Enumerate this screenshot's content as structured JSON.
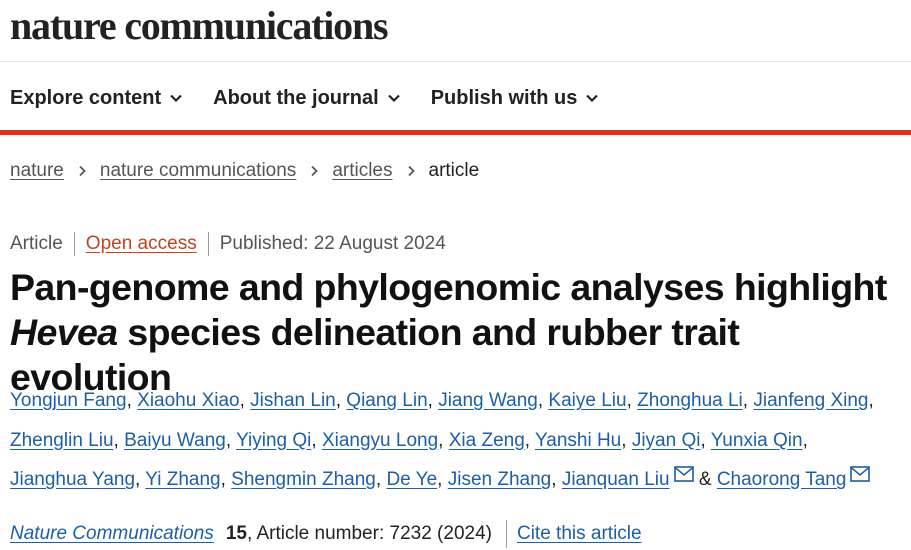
{
  "site": {
    "logo_text": "nature communications"
  },
  "nav": {
    "items": [
      {
        "label": "Explore content",
        "icon": "chevron-down-icon"
      },
      {
        "label": "About the journal",
        "icon": "chevron-down-icon"
      },
      {
        "label": "Publish with us",
        "icon": "chevron-down-icon"
      }
    ]
  },
  "breadcrumb": {
    "items": [
      "nature",
      "nature communications",
      "articles"
    ],
    "current": "article"
  },
  "article": {
    "type": "Article",
    "access": "Open access",
    "published": "Published: 22 August 2024",
    "title_part1": "Pan-genome and phylogenomic analyses highlight",
    "title_italic": "Hevea",
    "title_part2": "species delineation and rubber trait evolution",
    "authors": [
      "Yongjun Fang",
      "Xiaohu Xiao",
      "Jishan Lin",
      "Qiang Lin",
      "Jiang Wang",
      "Kaiye Liu",
      "Zhonghua Li",
      "Jianfeng Xing",
      "Zhenglin Liu",
      "Baiyu Wang",
      "Yiying Qi",
      "Xiangyu Long",
      "Xia Zeng",
      "Yanshi Hu",
      "Jiyan Qi",
      "Yunxia Qin",
      "Jianghua Yang",
      "Yi Zhang",
      "Shengmin Zhang",
      "De Ye",
      "Jisen Zhang",
      "Jianquan Liu",
      "Chaorong Tang"
    ],
    "ampersand": "&",
    "journal": "Nature Communications",
    "volume": "15",
    "article_number": ", Article number: 7232 (2024)",
    "cite_label": "Cite this article"
  },
  "colors": {
    "accent_red": "#e0301e",
    "link_blue": "#1b5faa",
    "open_access": "#c0451c"
  }
}
